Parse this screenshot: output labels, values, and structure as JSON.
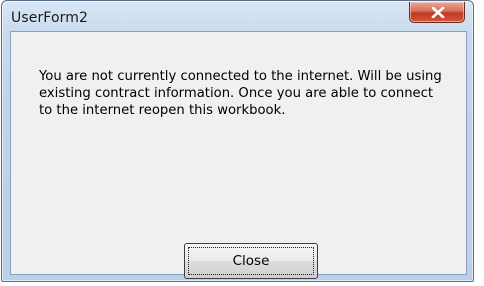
{
  "window": {
    "title": "UserForm2"
  },
  "titlebar": {
    "close_icon": "close-x-icon"
  },
  "message": {
    "text": "You are not currently connected to the internet. Will be using existing contract information. Once you are able to connect to the internet reopen this workbook."
  },
  "buttons": {
    "close_label": "Close"
  },
  "colors": {
    "frame": "#c0d3ea",
    "client_bg": "#f0f0f0",
    "close_button": "#c2391f"
  }
}
